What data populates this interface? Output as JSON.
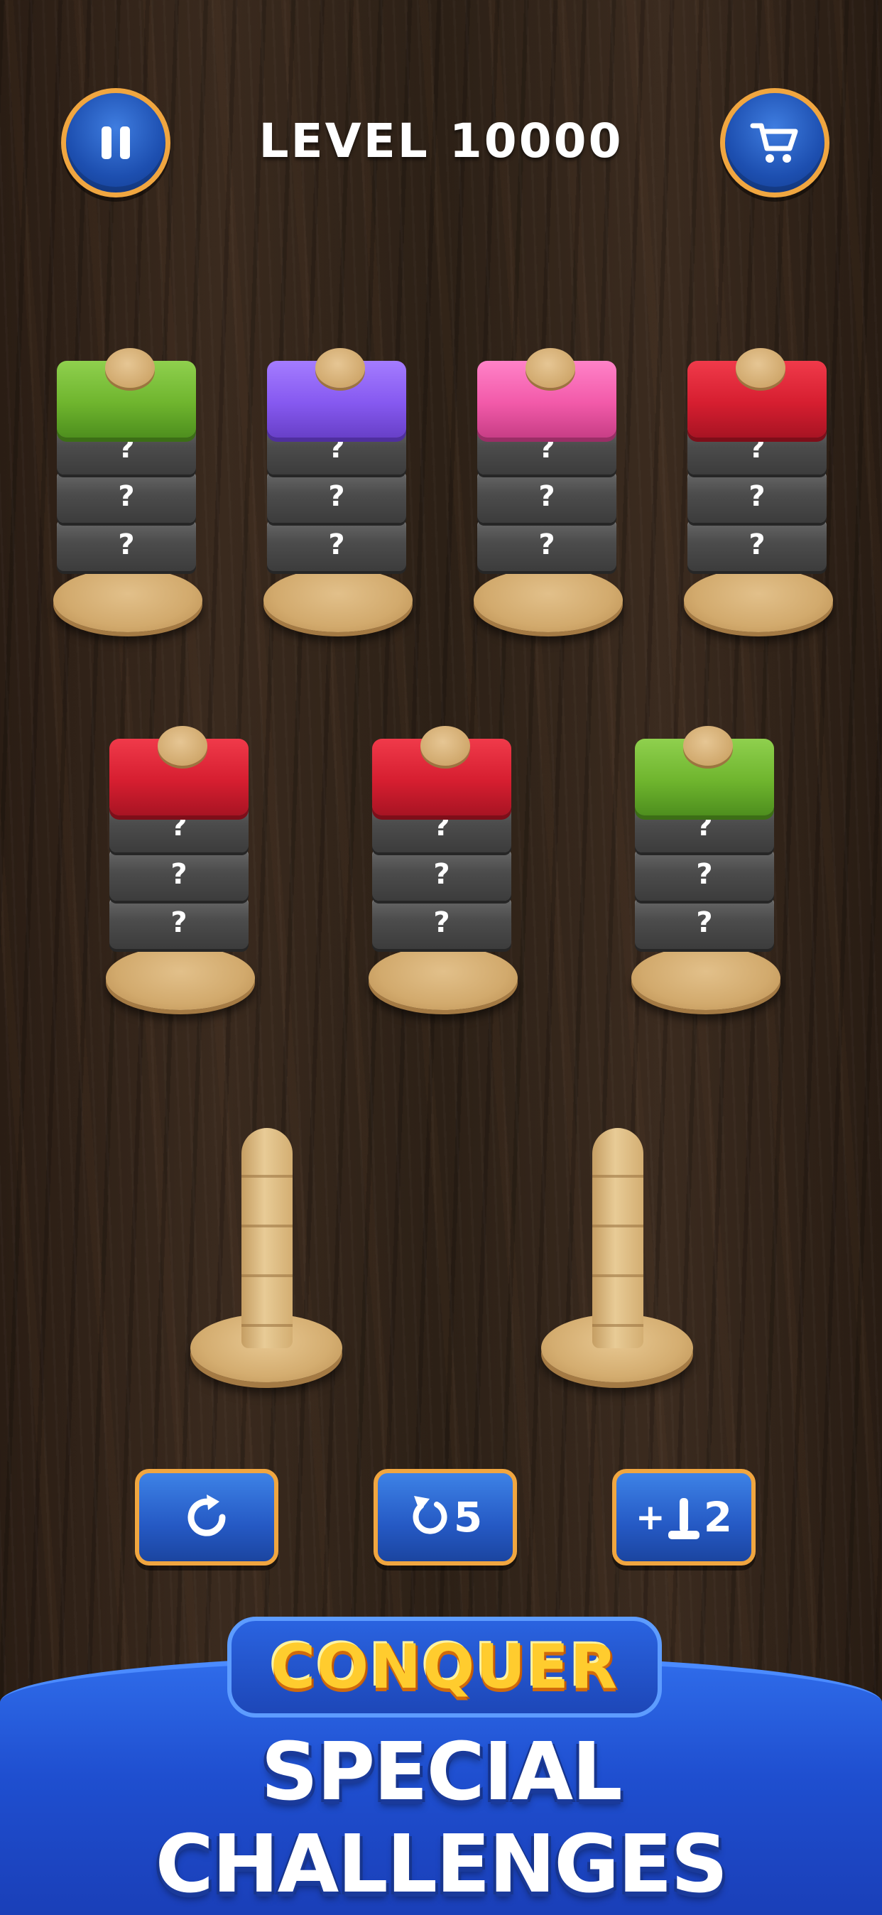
{
  "header": {
    "level_word": "LEVEL",
    "level_number": "10000",
    "pause_icon": "pause-icon",
    "shop_icon": "cart-icon"
  },
  "board": {
    "row1": [
      {
        "top_color": "green",
        "hidden": [
          "?",
          "?",
          "?"
        ]
      },
      {
        "top_color": "purple",
        "hidden": [
          "?",
          "?",
          "?"
        ]
      },
      {
        "top_color": "pink",
        "hidden": [
          "?",
          "?",
          "?"
        ]
      },
      {
        "top_color": "red",
        "hidden": [
          "?",
          "?",
          "?"
        ]
      }
    ],
    "row2": [
      {
        "top_color": "red",
        "hidden": [
          "?",
          "?",
          "?"
        ]
      },
      {
        "top_color": "red",
        "hidden": [
          "?",
          "?",
          "?"
        ]
      },
      {
        "top_color": "green",
        "hidden": [
          "?",
          "?",
          "?"
        ]
      }
    ],
    "empty_pegs": 2
  },
  "actions": {
    "restart_icon": "restart-icon",
    "undo_icon": "undo-icon",
    "undo_count": "5",
    "add_peg_icon": "add-peg-icon",
    "add_peg_prefix": "+",
    "add_peg_count": "2"
  },
  "banner": {
    "line1": "CONQUER",
    "line2": "SPECIAL CHALLENGES"
  },
  "colors": {
    "green": "#6fb52e",
    "purple": "#8659f0",
    "pink": "#f25aa9",
    "red": "#d61e30",
    "button_blue": "#2559c4",
    "button_border": "#f0a640"
  }
}
